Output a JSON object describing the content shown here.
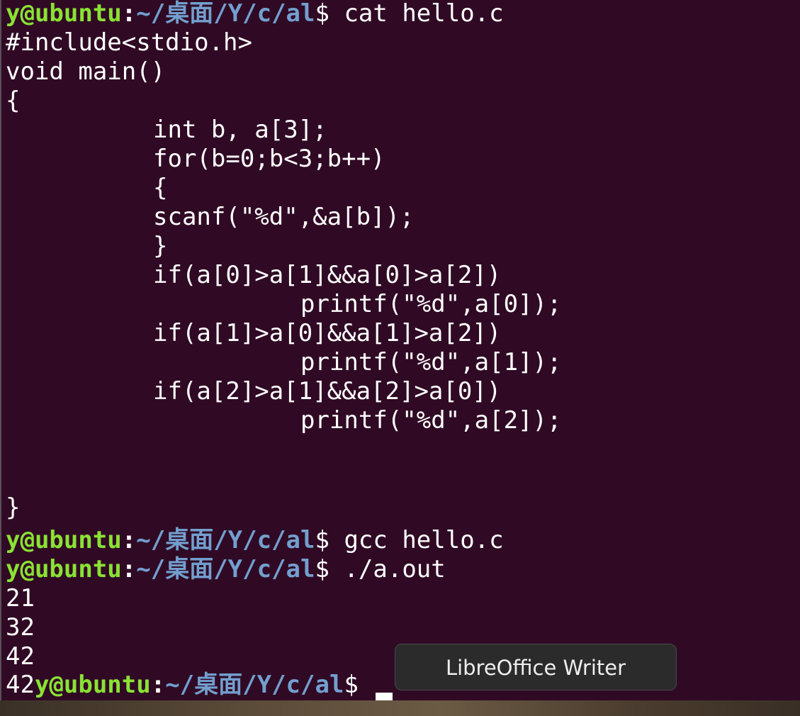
{
  "prompt": {
    "user_host": "y@ubuntu",
    "colon": ":",
    "path": "~/桌面/Y/c/al",
    "dollar": "$"
  },
  "commands": {
    "cat": "cat hello.c",
    "gcc": "gcc hello.c",
    "run": "./a.out"
  },
  "source_code": {
    "l1": "#include<stdio.h>",
    "l2": "void main()",
    "l3": "{",
    "l4": "int b, a[3];",
    "l5": "for(b=0;b<3;b++)",
    "l6": "{",
    "l7": "scanf(\"%d\",&a[b]);",
    "l8": "}",
    "l9": "if(a[0]>a[1]&&a[0]>a[2])",
    "l10": "printf(\"%d\",a[0]);",
    "l11": "if(a[1]>a[0]&&a[1]>a[2])",
    "l12": "printf(\"%d\",a[1]);",
    "l13": "if(a[2]>a[1]&&a[2]>a[0])",
    "l14": "printf(\"%d\",a[2]);",
    "l15": "}"
  },
  "program_output": {
    "input1": "21",
    "input2": "32",
    "input3": "42",
    "result": "42"
  },
  "tooltip": {
    "label": "LibreOffice Writer"
  },
  "colors": {
    "terminal_bg": "#300a24",
    "prompt_user": "#8ae234",
    "prompt_path": "#729fcf",
    "text": "#ffffff",
    "subtitle": "#ffe100"
  }
}
